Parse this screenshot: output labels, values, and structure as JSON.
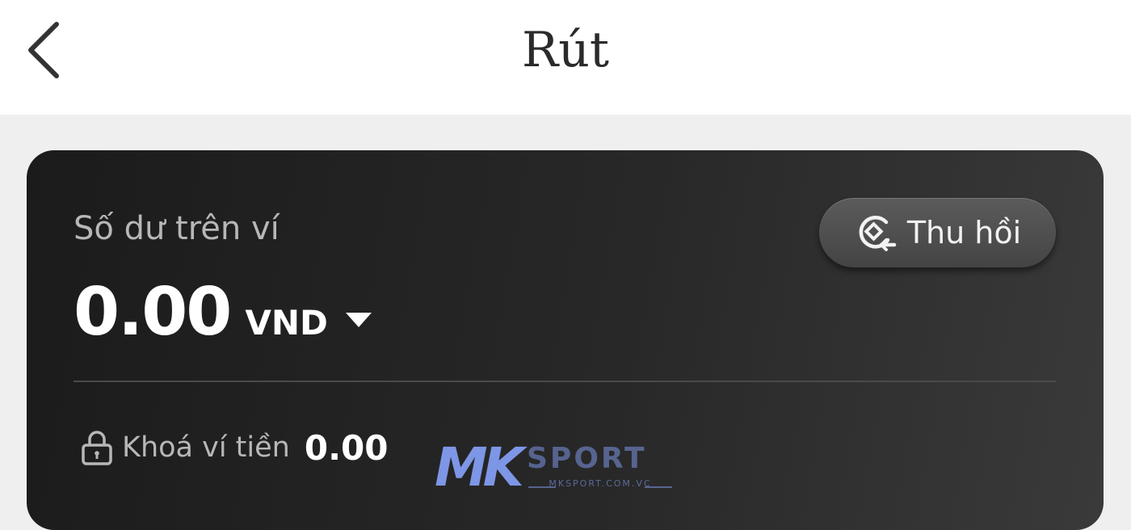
{
  "header": {
    "title": "Rút",
    "back_icon": "chevron-left-icon"
  },
  "wallet": {
    "label": "Số dư trên ví",
    "amount": "0.00",
    "currency": "VND",
    "currency_icon": "caret-down-icon",
    "recall_button": {
      "label": "Thu hồi",
      "icon": "recall-icon"
    },
    "locked": {
      "icon": "lock-icon",
      "label": "Khoá ví tiền",
      "amount": "0.00"
    }
  },
  "watermark": {
    "brand_mark": "MK",
    "brand_text": "SPORT",
    "domain": "MKSPORT.COM.VC"
  },
  "colors": {
    "header_bg": "#ffffff",
    "page_bg": "#efefef",
    "card_bg": "#242424",
    "button_bg": "#4f4f4f",
    "text_primary": "#ffffff",
    "text_secondary": "#b7b7b7",
    "watermark": "#7d96e6"
  }
}
